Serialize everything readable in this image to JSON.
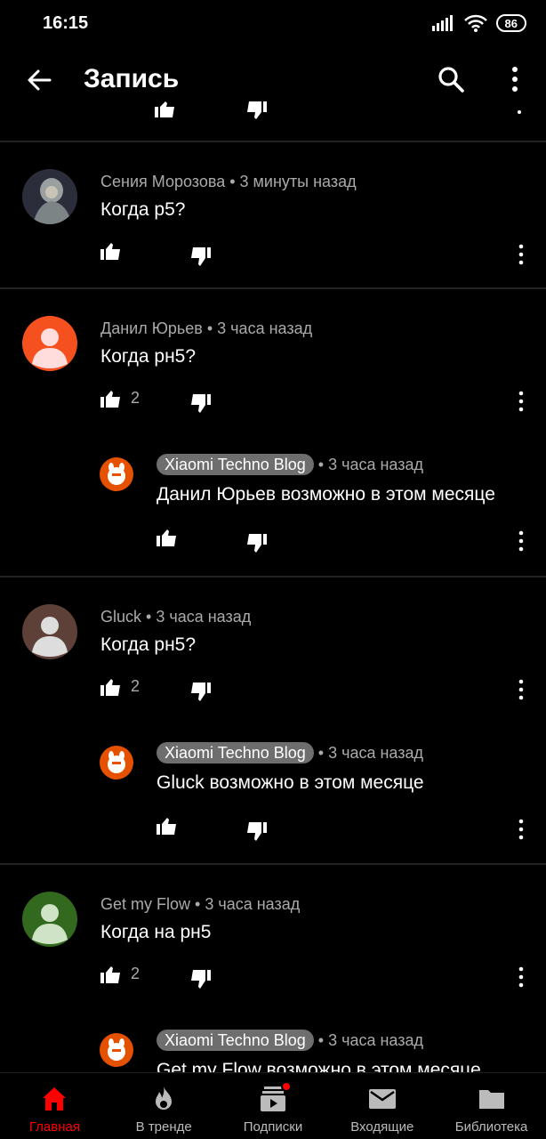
{
  "status": {
    "time": "16:15",
    "battery": "86"
  },
  "app_bar": {
    "title": "Запись"
  },
  "comments": [
    {
      "author": "Сения Морозова",
      "time": "3 минуты назад",
      "text": "Когда р5?",
      "likes": ""
    },
    {
      "author": "Данил Юрьев",
      "time": "3 часа назад",
      "text": "Когда рн5?",
      "likes": "2"
    },
    {
      "author": "Xiaomi Techno Blog",
      "time": "3 часа назад",
      "text": "Данил Юрьев возможно в этом месяце",
      "likes": ""
    },
    {
      "author": "Gluck",
      "time": "3 часа назад",
      "text": "Когда рн5?",
      "likes": "2"
    },
    {
      "author": "Xiaomi Techno Blog",
      "time": "3 часа назад",
      "text": "Gluck возможно в этом месяце",
      "likes": ""
    },
    {
      "author": "Get my Flow",
      "time": "3 часа назад",
      "text": "Когда на рн5",
      "likes": "2"
    },
    {
      "author": "Xiaomi Techno Blog",
      "time": "3 часа назад",
      "text": "Get my Flow возможно в этом месяце",
      "likes": ""
    }
  ],
  "nav": [
    {
      "label": "Главная",
      "icon": "home-icon",
      "active": true
    },
    {
      "label": "В тренде",
      "icon": "flame-icon"
    },
    {
      "label": "Подписки",
      "icon": "subscriptions-icon"
    },
    {
      "label": "Входящие",
      "icon": "mail-icon"
    },
    {
      "label": "Библиотека",
      "icon": "folder-icon"
    }
  ],
  "colors": {
    "background": "#000000",
    "accent": "#ff0000",
    "meta_text": "#aaaaaa",
    "avatar_danil": "#f4511e",
    "avatar_gluck": "#5d4037",
    "avatar_flow": "#33691e",
    "channel_avatar": "#e65100"
  }
}
